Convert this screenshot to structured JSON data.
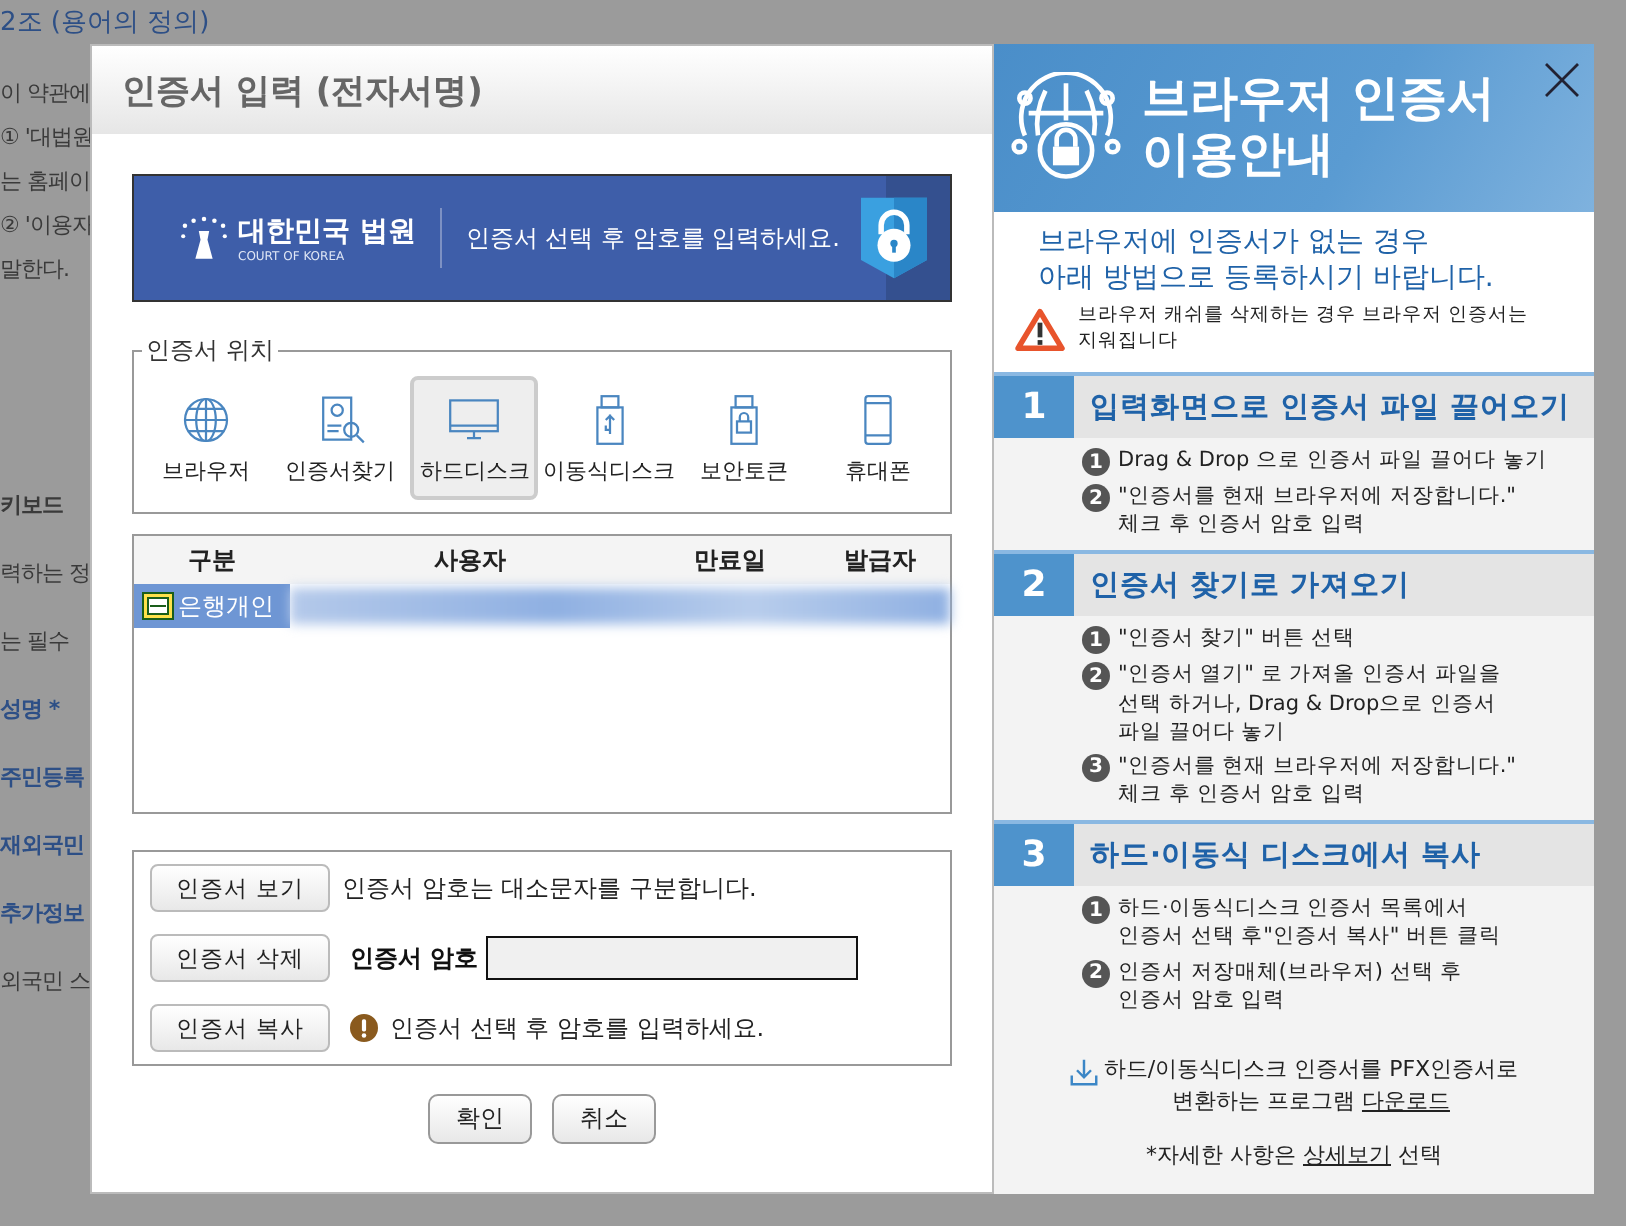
{
  "background_page": {
    "heading": "2조 (용어의 정의)",
    "lines": [
      "이 약관에",
      "① '대법원",
      "는 홈페이",
      "② '이용자",
      "말한다."
    ],
    "fields": [
      {
        "kind": "label",
        "text": "키보드"
      },
      {
        "kind": "text",
        "text": "력하는 정"
      },
      {
        "kind": "text",
        "text": "는 필수"
      },
      {
        "kind": "required",
        "text": "성명 *"
      },
      {
        "kind": "required",
        "text": "주민등록"
      },
      {
        "kind": "required",
        "text": "재외국민"
      },
      {
        "kind": "required",
        "text": "추가정보"
      },
      {
        "kind": "text",
        "text": "외국민 스"
      }
    ]
  },
  "dialog": {
    "title": "인증서 입력 (전자서명)",
    "banner": {
      "logo_name": "대한민국 법원",
      "logo_sub": "COURT OF KOREA",
      "message": "인증서 선택 후 암호를 입력하세요."
    },
    "location": {
      "legend": "인증서 위치",
      "options": [
        {
          "kind": "globe",
          "label": "브라우저",
          "selected": false
        },
        {
          "kind": "search",
          "label": "인증서찾기",
          "selected": false
        },
        {
          "kind": "monitor",
          "label": "하드디스크",
          "selected": true
        },
        {
          "kind": "usb",
          "label": "이동식디스크",
          "selected": false
        },
        {
          "kind": "token",
          "label": "보안토큰",
          "selected": false
        },
        {
          "kind": "phone",
          "label": "휴대폰",
          "selected": false
        }
      ]
    },
    "table": {
      "columns": [
        "구분",
        "사용자",
        "만료일",
        "발급자"
      ],
      "rows": [
        {
          "type": "은행개인",
          "selected": true
        }
      ]
    },
    "actions": [
      {
        "label": "인증서 보기"
      },
      {
        "label": "인증서 삭제"
      },
      {
        "label": "인증서 복사"
      }
    ],
    "case_notice": "인증서 암호는 대소문자를 구분합니다.",
    "password_label": "인증서 암호",
    "warning": "인증서 선택 후 암호를 입력하세요.",
    "buttons": [
      "확인",
      "취소"
    ]
  },
  "guide": {
    "title_line1": "브라우저 인증서",
    "title_line2": "이용안내",
    "intro": "브라우저에 인증서가 없는 경우\n아래 방법으로 등록하시기 바랍니다.",
    "caution": "브라우저 캐쉬를 삭제하는 경우 브라우저 인증서는\n지워집니다",
    "steps": [
      {
        "number": "1",
        "title": "입력화면으로 인증서 파일 끌어오기",
        "items": [
          {
            "marker": "1",
            "text": "Drag & Drop 으로 인증서 파일 끌어다 놓기"
          },
          {
            "marker": "2",
            "text": " \"인증서를 현재 브라우저에 저장합니다.\"\n체크 후 인증서 암호 입력"
          }
        ]
      },
      {
        "number": "2",
        "title": "인증서 찾기로 가져오기",
        "items": [
          {
            "marker": "1",
            "text": "\"인증서 찾기\" 버튼 선택"
          },
          {
            "marker": "2",
            "text": "\"인증서 열기\" 로 가져올 인증서 파일을\n선택 하거나, Drag & Drop으로 인증서\n파일 끌어다 놓기"
          },
          {
            "marker": "3",
            "text": "\"인증서를 현재 브라우저에 저장합니다.\"\n체크 후 인증서 암호 입력"
          }
        ]
      },
      {
        "number": "3",
        "title": "하드·이동식 디스크에서 복사",
        "items": [
          {
            "marker": "1",
            "text": "하드·이동식디스크 인증서 목록에서\n인증서 선택 후\"인증서 복사\" 버튼 클릭"
          },
          {
            "marker": "2",
            "text": "인증서 저장매체(브라우저) 선택 후\n인증서 암호 입력"
          }
        ]
      }
    ],
    "download": {
      "text": "하드/이동식디스크 인증서를 PFX인증서로\n변환하는 프로그램",
      "link": "다운로드"
    },
    "detail": {
      "before": "*자세한 사항은",
      "link": "상세보기",
      "after": "선택"
    }
  }
}
